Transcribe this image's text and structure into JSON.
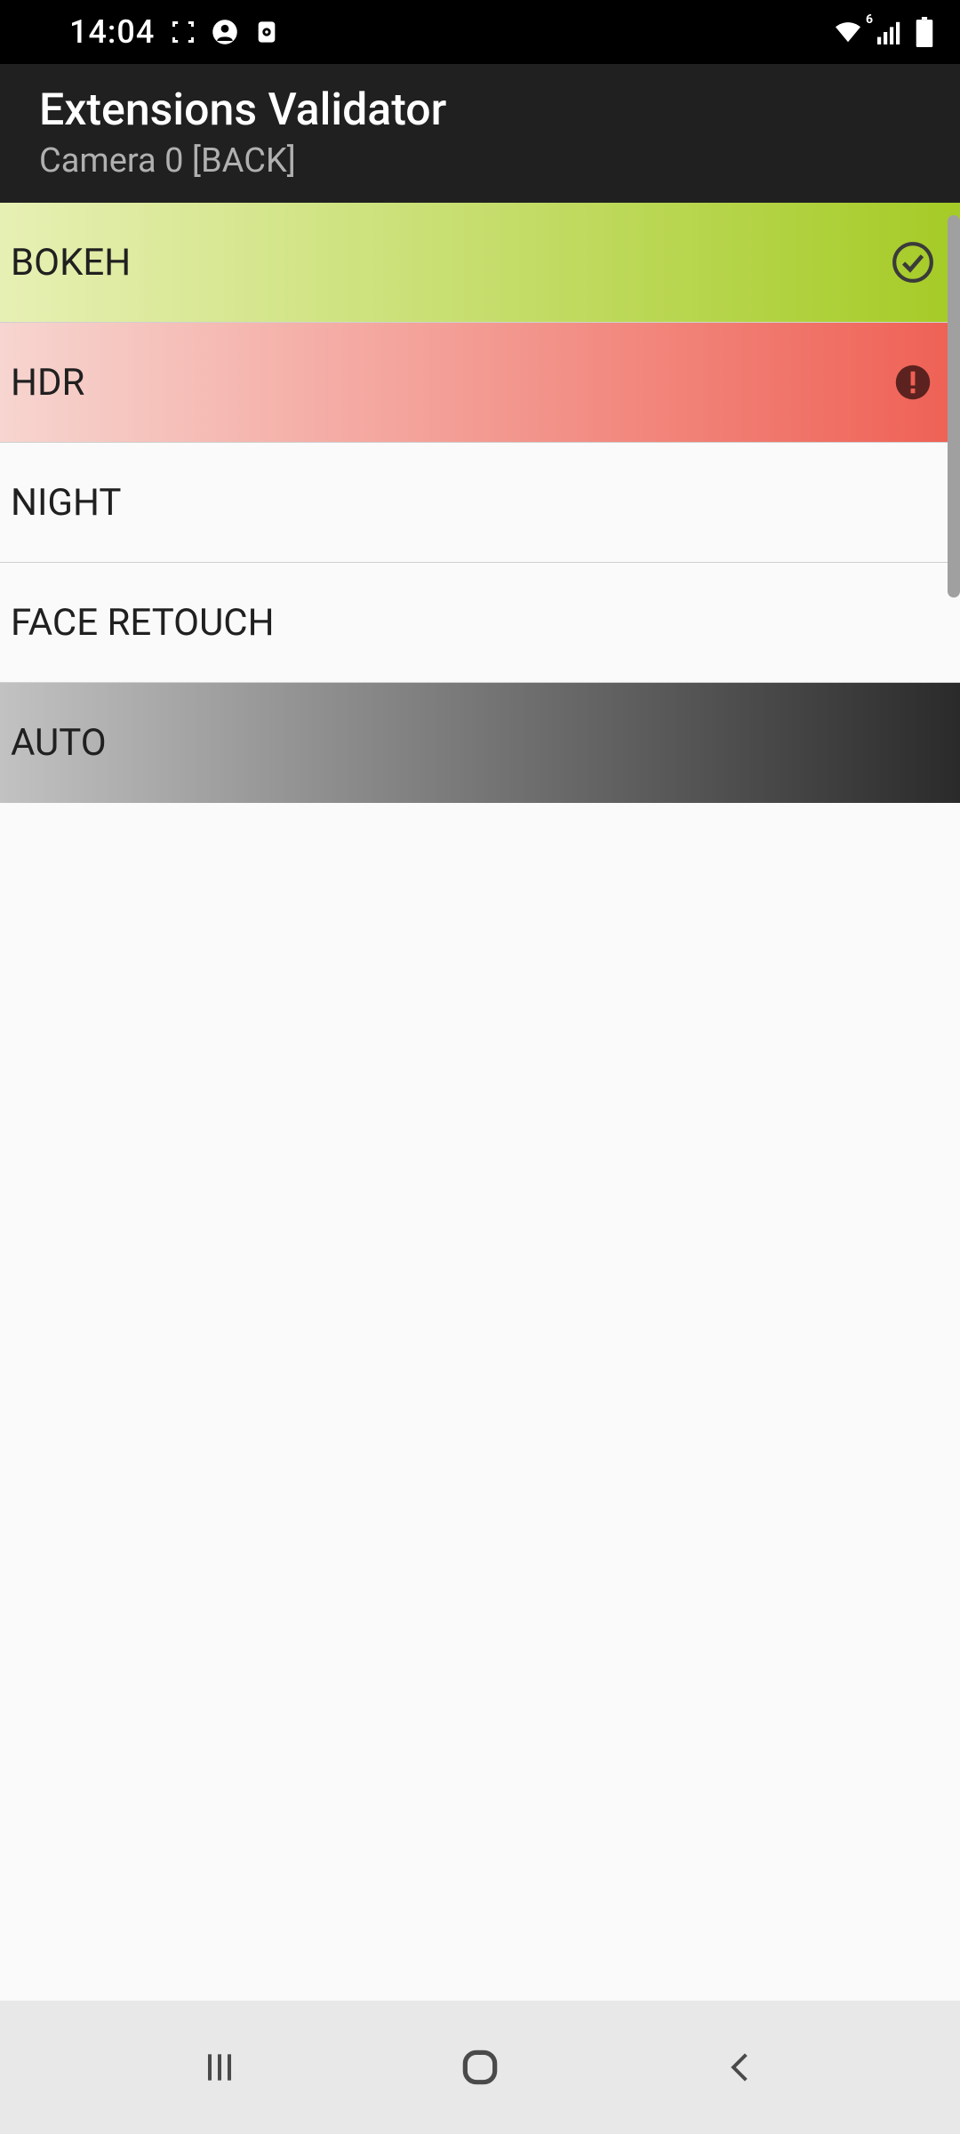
{
  "status": {
    "time": "14:04",
    "wifi_badge": "6"
  },
  "appBar": {
    "title": "Extensions Validator",
    "subtitle": "Camera 0 [BACK]"
  },
  "list": {
    "items": [
      {
        "label": "BOKEH",
        "status": "success"
      },
      {
        "label": "HDR",
        "status": "error"
      },
      {
        "label": "NIGHT",
        "status": "none"
      },
      {
        "label": "FACE RETOUCH",
        "status": "none"
      },
      {
        "label": "AUTO",
        "status": "none"
      }
    ]
  },
  "colors": {
    "success_start": "#e7f0b4",
    "success_end": "#a5cb26",
    "error_start": "#f7d5d0",
    "error_end": "#ef6054",
    "gray_start": "#c2c2c2",
    "gray_end": "#2a2a2a"
  }
}
